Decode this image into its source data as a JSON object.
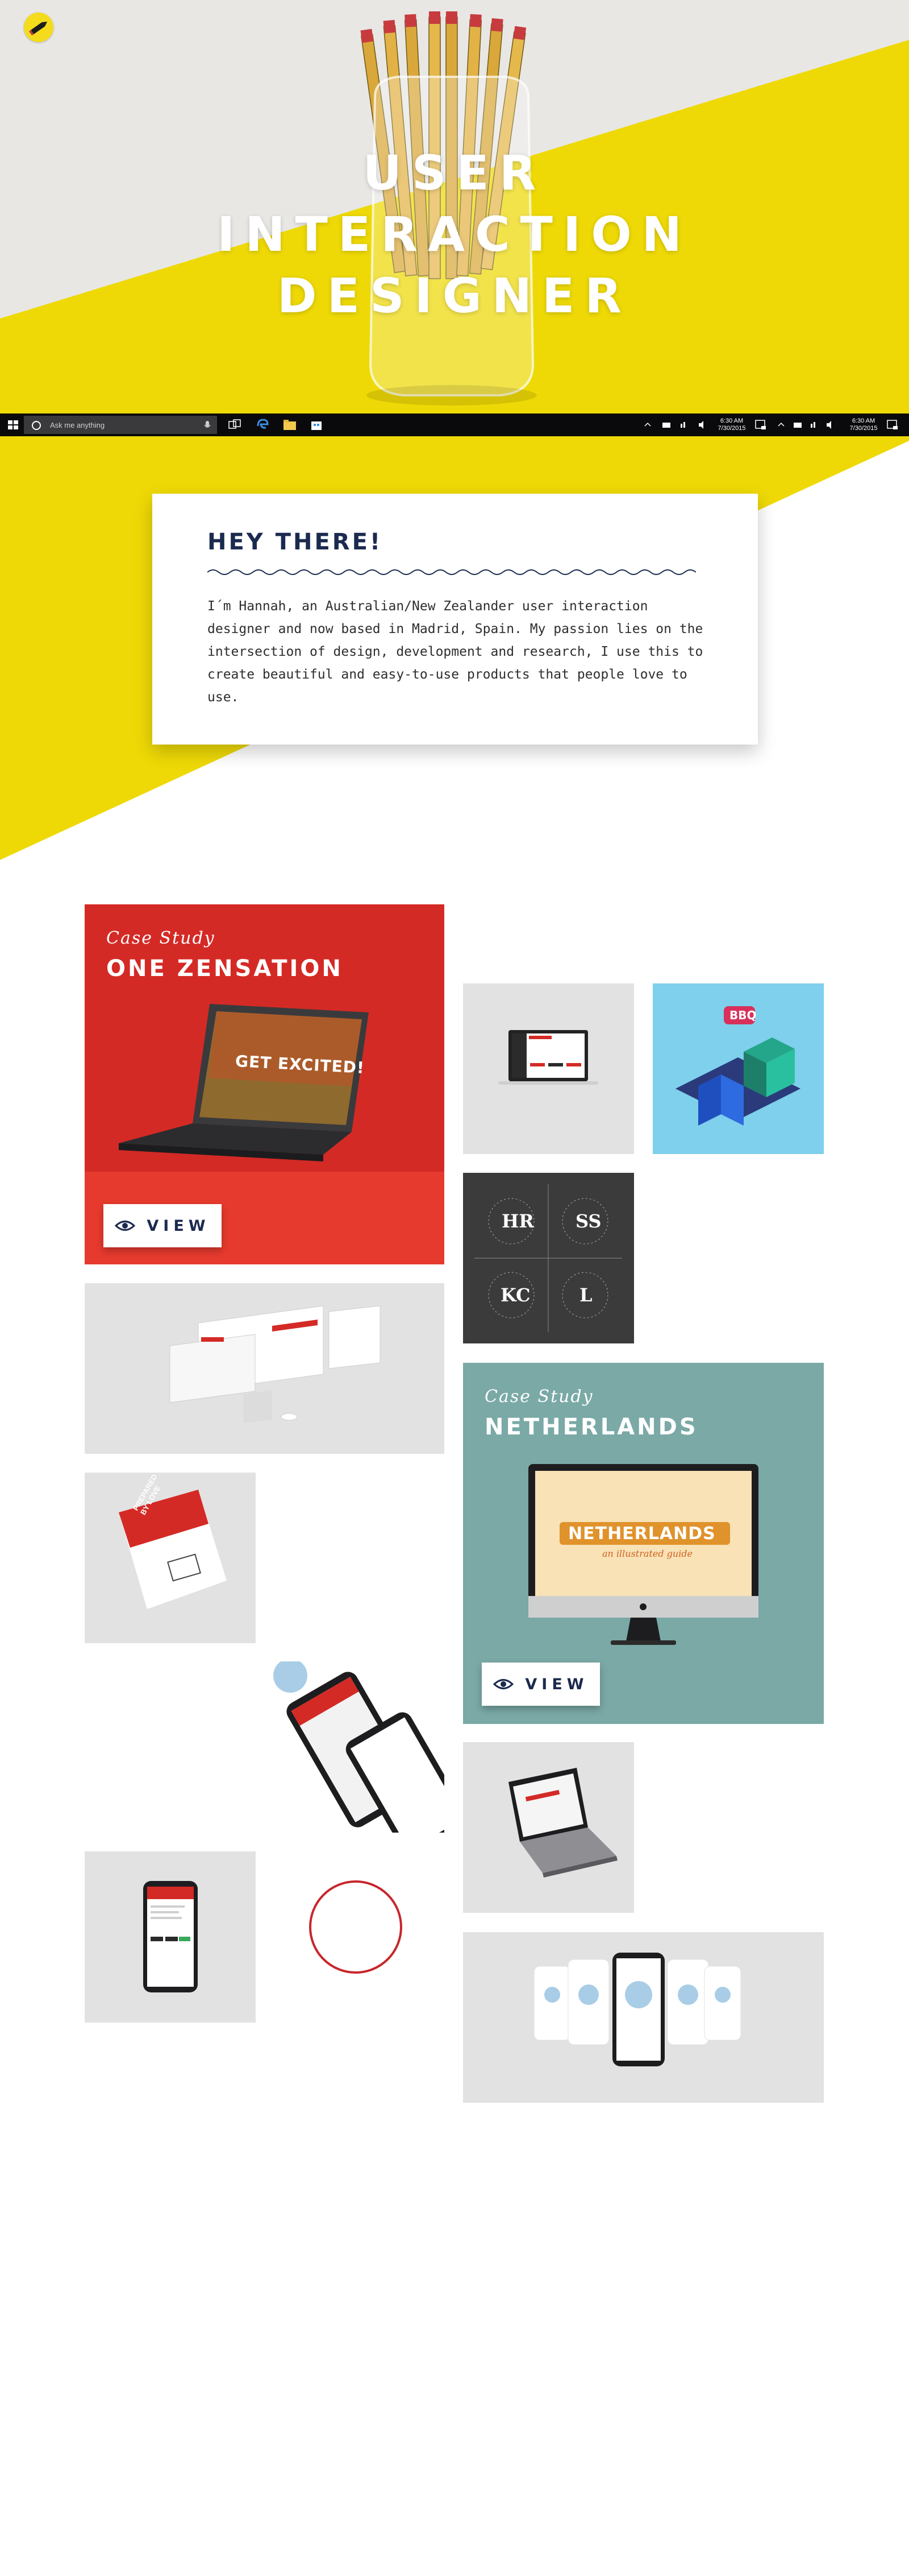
{
  "hero": {
    "title_lines": [
      "USER",
      "INTERACTION",
      "DESIGNER"
    ],
    "logo_icon": "pencil-icon",
    "colors": {
      "grey": "#e8e7e4",
      "yellow": "#eed906"
    }
  },
  "taskbar": {
    "search_placeholder": "Ask me anything",
    "clock_1": {
      "time": "6:30 AM",
      "date": "7/30/2015"
    },
    "clock_2": {
      "time": "6:30 AM",
      "date": "7/30/2015"
    },
    "icons": [
      "windows-start-icon",
      "cortana-icon",
      "microphone-icon",
      "task-view-icon",
      "edge-icon",
      "file-explorer-icon",
      "store-icon"
    ]
  },
  "intro": {
    "heading": "HEY THERE!",
    "text": "I´m Hannah, an Australian/New Zealander user interaction designer and now based in Madrid, Spain. My passion lies on the intersection of design, development and research, I use this to create beautiful and easy-to-use products that people love to use."
  },
  "portfolio": {
    "case_1": {
      "label": "Case Study",
      "title": "ONE ZENSATION",
      "screen_text": "GET EXCITED!",
      "button": "VIEW",
      "color": "#d42a26"
    },
    "case_2": {
      "label": "Case Study",
      "title": "NETHERLANDS",
      "screen_text": "NETHERLANDS",
      "screen_subtext": "an illustrated guide",
      "button": "VIEW",
      "color": "#7aa9a6"
    },
    "iso_sign": "BBQ",
    "logo_grid": {
      "top_left": "HR",
      "top_right": "SS",
      "bottom_left": "KC",
      "bottom_right": "L"
    },
    "flyer_text": "PREPARED BY LOVE"
  }
}
